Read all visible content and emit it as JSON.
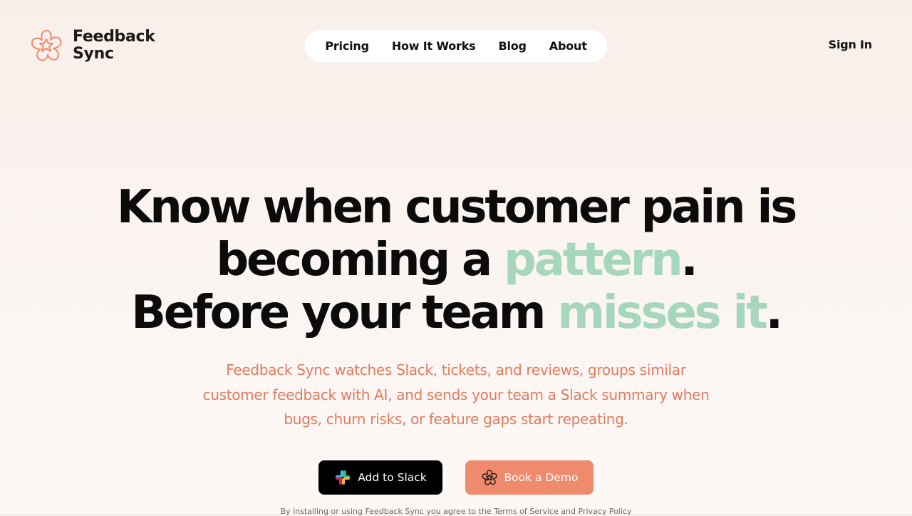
{
  "header": {
    "logo": {
      "line1": "Feedback",
      "line2": "Sync",
      "icon": "flower-logo-icon"
    },
    "nav": [
      "Pricing",
      "How It Works",
      "Blog",
      "About"
    ],
    "sign_in": "Sign In"
  },
  "hero": {
    "line1": "Know when customer pain is",
    "line2_pre": "becoming a ",
    "line2_accent": "pattern",
    "line2_post": ".",
    "line3_pre": "Before your team ",
    "line3_accent": "misses it",
    "line3_post": ".",
    "subtext_lines": [
      "Feedback Sync watches Slack, tickets, and reviews, groups similar",
      "customer feedback with AI, and sends your team a Slack summary when",
      "bugs, churn risks, or feature gaps start repeating."
    ]
  },
  "cta": {
    "primary": {
      "label": "Add to Slack",
      "icon": "slack-icon"
    },
    "secondary": {
      "label": "Book a Demo",
      "icon": "flower-logo-icon"
    }
  },
  "legal": "By installing or using Feedback Sync you agree to the Terms of Service and Privacy Policy",
  "colors": {
    "accent_green": "#a6d6bb",
    "brand_coral": "#f08a6d",
    "subtext_coral": "#e27b5e",
    "background": "#f9efea"
  }
}
